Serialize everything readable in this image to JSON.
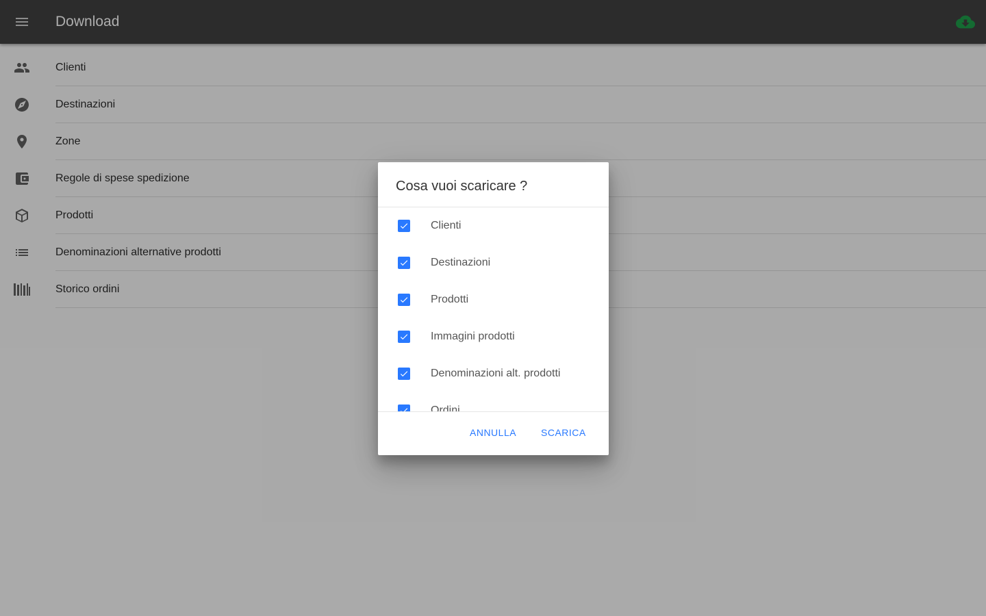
{
  "appbar": {
    "title": "Download",
    "menu_icon": "menu-icon",
    "action_icon": "cloud-download-icon",
    "action_color": "#1e9e4a"
  },
  "list": [
    {
      "label": "Clienti",
      "icon": "people-icon"
    },
    {
      "label": "Destinazioni",
      "icon": "compass-icon"
    },
    {
      "label": "Zone",
      "icon": "place-icon"
    },
    {
      "label": "Regole di spese spedizione",
      "icon": "wallet-icon"
    },
    {
      "label": "Prodotti",
      "icon": "box-icon"
    },
    {
      "label": "Denominazioni alternative prodotti",
      "icon": "list-icon"
    },
    {
      "label": "Storico ordini",
      "icon": "library-icon"
    }
  ],
  "dialog": {
    "title": "Cosa vuoi scaricare ?",
    "options": [
      {
        "label": "Clienti",
        "checked": true
      },
      {
        "label": "Destinazioni",
        "checked": true
      },
      {
        "label": "Prodotti",
        "checked": true
      },
      {
        "label": "Immagini prodotti",
        "checked": true
      },
      {
        "label": "Denominazioni alt. prodotti",
        "checked": true
      },
      {
        "label": "Ordini",
        "checked": true
      }
    ],
    "cancel_label": "ANNULLA",
    "confirm_label": "SCARICA"
  },
  "colors": {
    "appbar_bg": "#424242",
    "accent": "#2979ff"
  }
}
